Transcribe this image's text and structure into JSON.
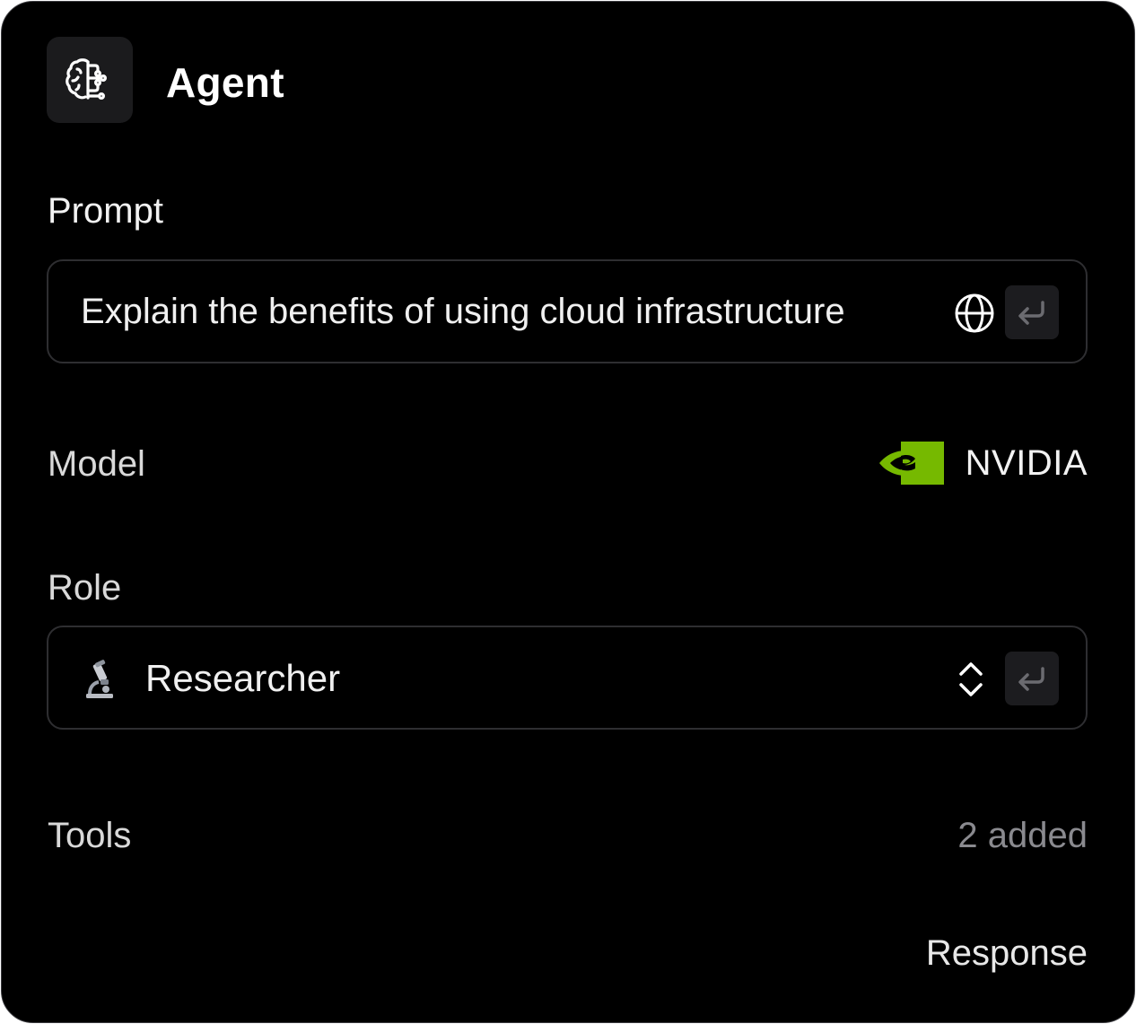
{
  "agent": {
    "icon": "brain-circuit-icon",
    "title": "Agent"
  },
  "prompt": {
    "label": "Prompt",
    "value": "Explain the benefits of using cloud infrastructure",
    "globe_icon": "globe-icon",
    "submit_icon": "enter-icon"
  },
  "model": {
    "label": "Model",
    "logo": "nvidia-logo",
    "value": "NVIDIA",
    "brand_color": "#76b900"
  },
  "role": {
    "label": "Role",
    "emoji_icon": "microscope-icon",
    "value": "Researcher",
    "selector_icon": "chevron-up-down-icon",
    "submit_icon": "enter-icon"
  },
  "tools": {
    "label": "Tools",
    "count_text": "2 added"
  },
  "footer": {
    "response_label": "Response"
  },
  "colors": {
    "background": "#000000",
    "border": "#2e2e31",
    "muted_text": "#8a8a8f"
  }
}
